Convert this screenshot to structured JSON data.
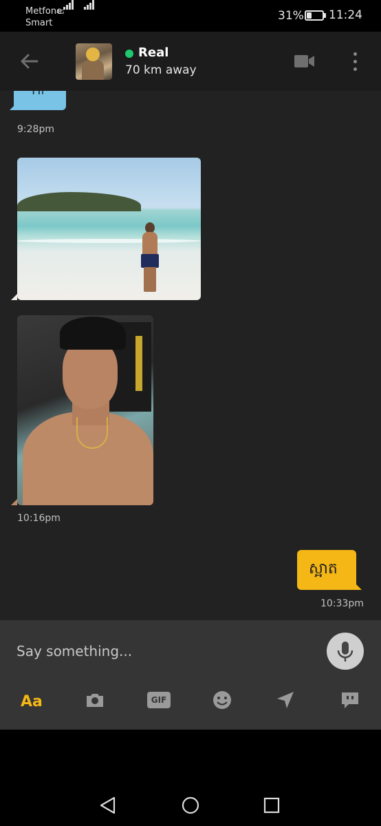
{
  "status_bar": {
    "carrier_1": "Metfone",
    "carrier_2": "Smart",
    "network": "4G",
    "battery_percent": "31%",
    "battery_level": 0.31,
    "time": "11:24"
  },
  "header": {
    "contact_name": "Real",
    "distance": "70 km away",
    "online": true,
    "online_color": "#1fc96e"
  },
  "messages": [
    {
      "direction": "incoming",
      "type": "text",
      "text": "Hi"
    },
    {
      "direction": "incoming",
      "type": "time",
      "text": "9:28pm"
    },
    {
      "direction": "incoming",
      "type": "photo",
      "icon": "beach-photo"
    },
    {
      "direction": "incoming",
      "type": "photo",
      "icon": "selfie-photo"
    },
    {
      "direction": "incoming",
      "type": "time",
      "text": "10:16pm"
    },
    {
      "direction": "outgoing",
      "type": "text",
      "text": "ស្អាត"
    },
    {
      "direction": "outgoing",
      "type": "time",
      "text": "10:33pm"
    }
  ],
  "composer": {
    "placeholder": "Say something...",
    "value": "",
    "toolbar": {
      "text_style_label": "Aa",
      "gif_label": "GIF",
      "icons": [
        "camera-icon",
        "gif-icon",
        "emoji-icon",
        "location-icon",
        "saved-phrases-icon"
      ]
    }
  },
  "colors": {
    "incoming_bubble": "#79c3e6",
    "outgoing_bubble": "#f4b716",
    "accent": "#f4b716",
    "background": "#222222"
  }
}
